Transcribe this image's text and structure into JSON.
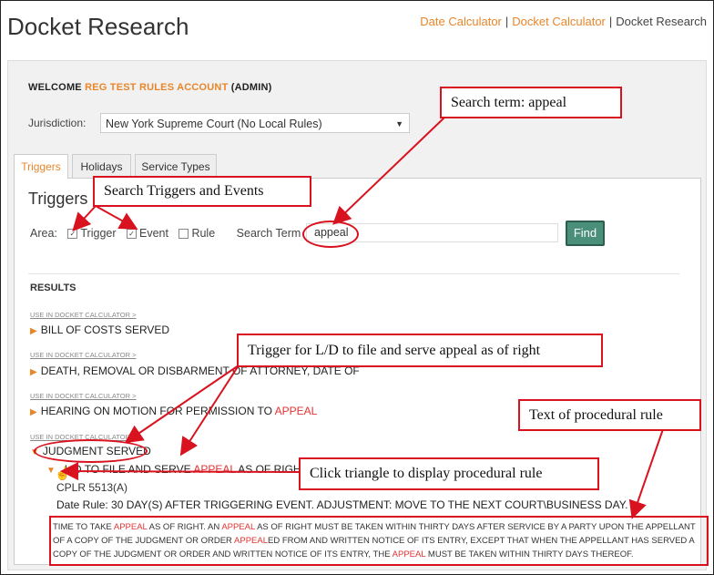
{
  "app": {
    "title": "Docket Research",
    "links": [
      "Date Calculator",
      "Docket Calculator"
    ],
    "current": "Docket Research",
    "separator": "|"
  },
  "welcome": {
    "prefix": "WELCOME",
    "account": "REG TEST RULES ACCOUNT",
    "role": "(ADMIN)"
  },
  "jurisdiction": {
    "label": "Jurisdiction:",
    "value": "New York Supreme Court (No Local Rules)"
  },
  "tabs": [
    "Triggers",
    "Holidays",
    "Service Types"
  ],
  "triggers": {
    "title": "Triggers",
    "area_label": "Area:",
    "options": [
      {
        "label": "Trigger",
        "checked": true
      },
      {
        "label": "Event",
        "checked": true
      },
      {
        "label": "Rule",
        "checked": false
      }
    ],
    "search_label": "Search Term",
    "search_value": "appeal",
    "find_label": "Find"
  },
  "results": {
    "heading": "RESULTS",
    "use_link": "USE IN DOCKET CALCULATOR >",
    "items": [
      {
        "before": "BILL OF COSTS SERVED",
        "hl": "",
        "after": ""
      },
      {
        "before": "DEATH, REMOVAL OR DISBARMENT OF ATTORNEY, DATE OF",
        "hl": "",
        "after": ""
      },
      {
        "before": "HEARING ON MOTION FOR PERMISSION TO ",
        "hl": "APPEAL",
        "after": ""
      },
      {
        "before": "JUDGMENT SERVED",
        "hl": "",
        "after": ""
      }
    ],
    "sub": {
      "before": "L/D TO FILE AND SERVE ",
      "hl": "APPEAL",
      "after": " AS OF RIGHT"
    },
    "cplr": "CPLR 5513(A)",
    "date_rule": "Date Rule: 30 DAY(S) AFTER TRIGGERING EVENT. ADJUSTMENT: MOVE TO THE NEXT COURT\\BUSINESS DAY.",
    "rule_text": [
      "TIME TO TAKE ",
      "APPEAL",
      " AS OF RIGHT. AN ",
      "APPEAL",
      " AS OF RIGHT MUST BE TAKEN WITHIN THIRTY DAYS AFTER SERVICE BY A PARTY UPON THE APPELLANT OF A COPY OF THE JUDGMENT OR ORDER ",
      "APPEAL",
      "ED FROM AND WRITTEN NOTICE OF ITS ENTRY, EXCEPT THAT WHEN THE APPELLANT HAS SERVED A COPY OF THE JUDGMENT OR ORDER AND WRITTEN NOTICE OF ITS ENTRY, THE ",
      "APPEAL",
      " MUST BE TAKEN WITHIN THIRTY DAYS THEREOF."
    ]
  },
  "callouts": {
    "search_term": "Search term:   appeal",
    "search_triggers": "Search Triggers and Events",
    "trigger_for": "Trigger for L/D to file and serve appeal as of right",
    "procedural": "Text of procedural rule",
    "click_triangle": "Click triangle to display procedural rule"
  },
  "colors": {
    "accent": "#e8862a",
    "highlight": "#e53333",
    "annotation": "#d9121f",
    "button": "#4a8f7a"
  }
}
